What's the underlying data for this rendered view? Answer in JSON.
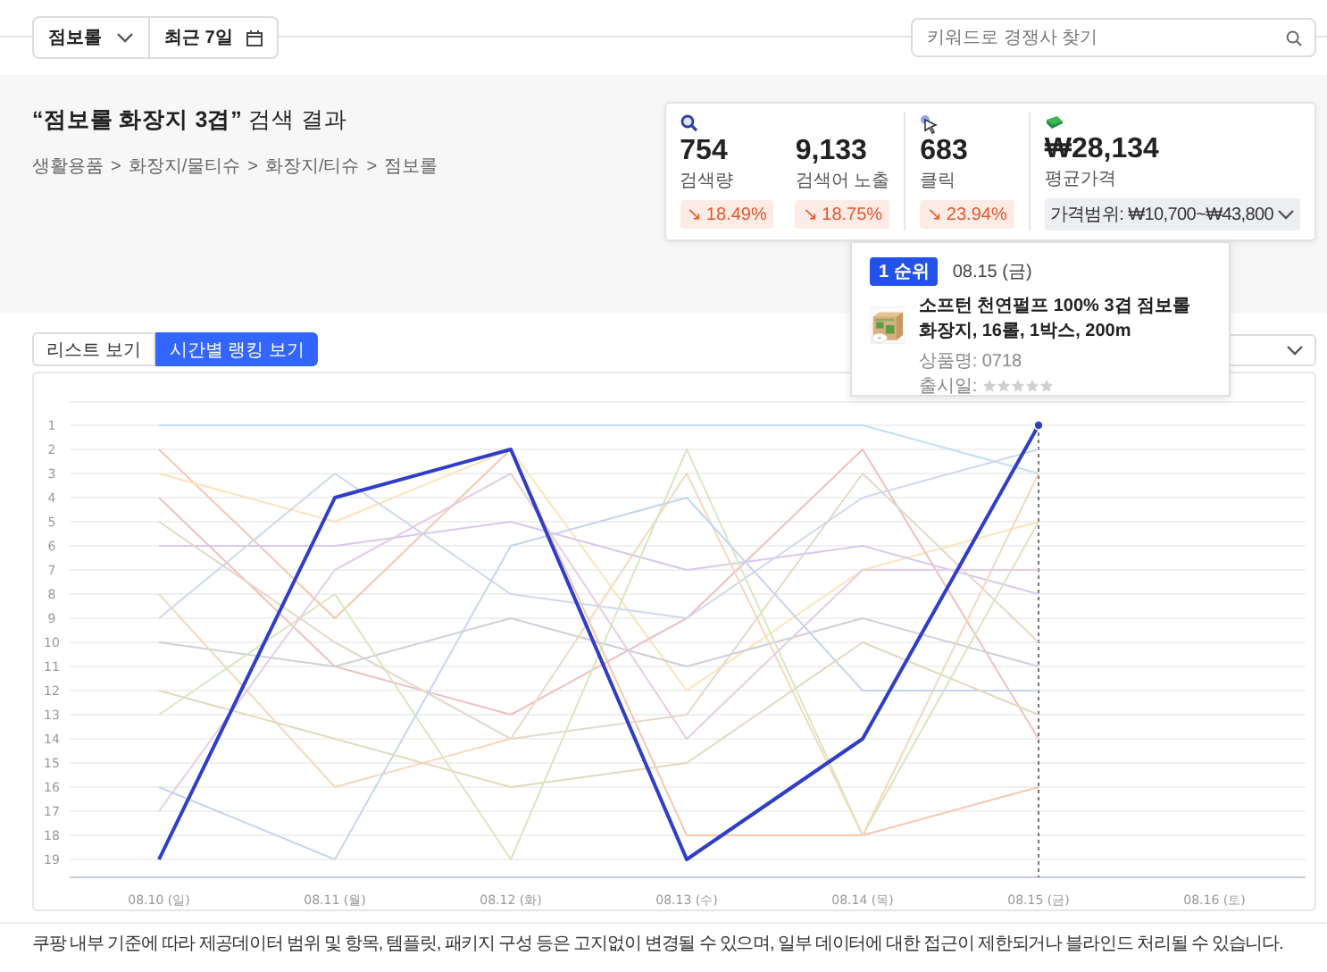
{
  "filters": {
    "category": {
      "label": "점보롤"
    },
    "period": {
      "label": "최근 7일"
    },
    "search": {
      "placeholder": "키워드로 경쟁사 찾기"
    }
  },
  "header": {
    "title": "**“점보롤 화장지 3겹”** 검색 결과",
    "breadcrumb": [
      "생활용품",
      "화장지/물티슈",
      "화장지/티슈",
      "점보롤"
    ],
    "separator": ">"
  },
  "stats": [
    {
      "value": "754",
      "label": "검색량",
      "arrow": "↘",
      "change": "18.49%"
    },
    {
      "value": "9,133",
      "label": "검색어 노출",
      "arrow": "↘",
      "change": "18.75%"
    },
    {
      "value": "683",
      "label": "클릭",
      "arrow": "↘",
      "change": "23.94%"
    },
    {
      "value": "₩28,134",
      "label": "평균가격",
      "range": "가격범위: ₩10,700~₩43,800"
    }
  ],
  "tooltip": {
    "rank": "1 순위",
    "date": "08.15 (금)",
    "product": "소프턴 천연펄프 100% 3겹 점보롤 화장지, 16롤, 1박스, 200m",
    "code": "상품명: 0718",
    "rating_label": "출시일:",
    "stars": 0
  },
  "view_tabs": [
    {
      "label": "리스트 보기",
      "selected": false
    },
    {
      "label": "시간별 랭킹 보기",
      "selected": true
    }
  ],
  "chart": {
    "chart_data": {
      "type": "line",
      "categories": [
        "08.10 (일)",
        "08.11 (월)",
        "08.12 (화)",
        "08.13 (수)",
        "08.14 (목)",
        "08.15 (금)",
        "08.16 (토)"
      ],
      "ylim": [
        19,
        1
      ],
      "grid": true,
      "ref_lines": [
        {
          "axis": "x",
          "value": "08.15 (금)"
        }
      ],
      "yticks": [
        1,
        2,
        3,
        4,
        5,
        6,
        7,
        8,
        9,
        10,
        11,
        12,
        13,
        14,
        15,
        16,
        17,
        18,
        19
      ],
      "series": [
        {
          "color": "#bfe0f7",
          "values": [
            1,
            1,
            1,
            1,
            1,
            3,
            null
          ]
        },
        {
          "color": "#f6c7ae",
          "values": [
            2,
            9,
            2,
            18,
            18,
            16,
            null
          ]
        },
        {
          "color": "#fde3b8",
          "values": [
            3,
            5,
            2,
            12,
            7,
            5,
            null
          ]
        },
        {
          "color": "#efc0c0",
          "values": [
            4,
            11,
            13,
            9,
            2,
            14,
            null
          ]
        },
        {
          "color": "#d8c8ee",
          "values": [
            6,
            6,
            5,
            7,
            6,
            8,
            null
          ]
        },
        {
          "color": "#e6d8c8",
          "values": [
            5,
            10,
            14,
            13,
            3,
            10,
            null
          ]
        },
        {
          "color": "#cdd8ee",
          "values": [
            9,
            3,
            8,
            9,
            4,
            2,
            null
          ]
        },
        {
          "color": "#d0d0dc",
          "values": [
            10,
            11,
            9,
            11,
            9,
            11,
            null
          ]
        },
        {
          "color": "#d8e8c0",
          "values": [
            13,
            8,
            19,
            2,
            18,
            5,
            null
          ]
        },
        {
          "color": "#f6d8bc",
          "values": [
            8,
            16,
            14,
            3,
            18,
            3,
            null
          ]
        },
        {
          "color": "#e8cce4",
          "values": [
            17,
            7,
            3,
            14,
            7,
            7,
            null
          ]
        },
        {
          "color": "#c4d6ee",
          "values": [
            16,
            19,
            6,
            4,
            12,
            12,
            null
          ]
        },
        {
          "color": "#e2dabc",
          "values": [
            12,
            14,
            16,
            15,
            10,
            13,
            null
          ]
        },
        {
          "color": "#2f3ec6",
          "values": [
            19,
            4,
            2,
            19,
            14,
            1,
            null
          ]
        }
      ]
    }
  },
  "footer": "쿠팡 내부 기준에 따라 제공데이터 범위 및 항목, 템플릿, 패키지 구성 등은 고지없이 변경될 수 있으며, 일부 데이터에 대한 접근이 제한되거나 블라인드 처리될 수 있습니다."
}
